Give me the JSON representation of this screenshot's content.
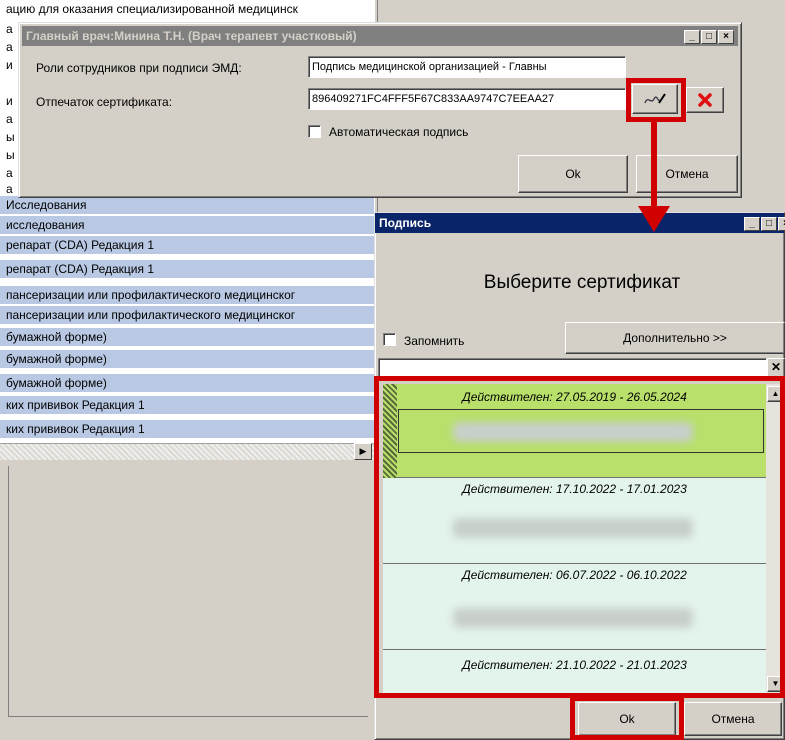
{
  "background_list": {
    "rows": [
      "ацию для оказания специализированной медицинск",
      "а",
      "а",
      "и",
      "и",
      "а",
      "ы",
      "ы",
      "а",
      "а",
      "Исследования",
      "исследования",
      "репарат (CDA) Редакция 1",
      "репарат (CDA) Редакция 1",
      "пансеризации или профилактического медицинског",
      "пансеризации или профилактического медицинског",
      "бумажной форме)",
      "бумажной форме)",
      "бумажной форме)",
      "ких прививок Редакция 1",
      "ких прививок Редакция 1"
    ]
  },
  "signer_window": {
    "title": "Главный врач:Минина Т.Н. (Врач терапевт участковый)",
    "roles_label": "Роли сотрудников при подписи ЭМД:",
    "roles_value": "Подпись медицинской организацией - Главны",
    "cert_label": "Отпечаток сертификата:",
    "cert_value": "896409271FC4FFF5F67C833AA9747C7EEAA27",
    "auto_sign_label": "Автоматическая подпись",
    "ok_label": "Ok",
    "cancel_label": "Отмена",
    "pick_cert_icon": "signature-pen-icon",
    "clear_icon": "red-x-icon"
  },
  "sign_dialog": {
    "title": "Подпись",
    "heading": "Выберите сертификат",
    "remember_label": "Запомнить",
    "more_button": "Дополнительно >>",
    "ok_label": "Ok",
    "cancel_label": "Отмена",
    "certificates": [
      {
        "validity": "Действителен: 27.05.2019 - 26.05.2024",
        "selected": true
      },
      {
        "validity": "Действителен: 17.10.2022 - 17.01.2023",
        "selected": false
      },
      {
        "validity": "Действителен: 06.07.2022 - 06.10.2022",
        "selected": false
      },
      {
        "validity": "Действителен: 21.10.2022 - 21.01.2023",
        "selected": false
      }
    ]
  },
  "colors": {
    "highlight_red": "#d10000",
    "selected_cert": "#b8e06a",
    "cert_bg": "#e3f4ec",
    "active_title": "#0a246a",
    "list_selection": "#b9c9e4"
  }
}
